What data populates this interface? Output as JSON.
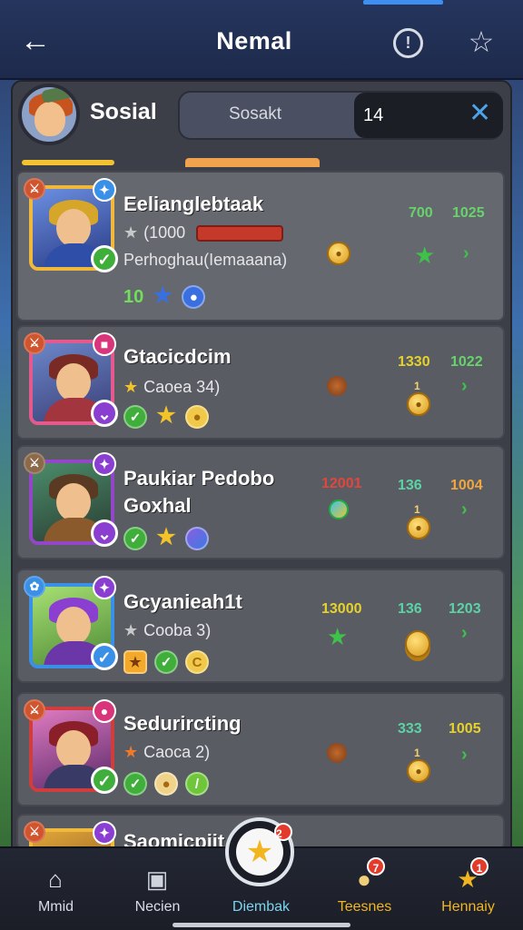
{
  "header": {
    "title": "Nemal"
  },
  "panel": {
    "title": "Sosial",
    "search_label": "Sosakt",
    "search_value": "14"
  },
  "heroes": [
    {
      "name": "Eelianglebtaak",
      "sub": "(1000",
      "desc": "Perhoghau(Iemaaana)",
      "level": "10",
      "stats": [
        "700",
        "1025"
      ],
      "frame": "#f0b93b",
      "badge_tr_color": "#3a8fe6",
      "badge_br_color": "#3fae3a"
    },
    {
      "name": "Gtacicdcim",
      "sub": "Caoea 34)",
      "stats": [
        "1330",
        "1022"
      ],
      "small": "1",
      "frame": "#e55a8d",
      "badge_tr_color": "#d8357a",
      "badge_br_color": "#8a3fd0"
    },
    {
      "name_line1": "Paukiar Pedobo",
      "name_line2": "Goxhal",
      "stats": [
        "12001",
        "136",
        "1004"
      ],
      "small": "1",
      "frame": "#9446c8",
      "badge_tr_color": "#8a3fd0",
      "badge_br_color": "#8a3fd0"
    },
    {
      "name": "Gcyanieah1t",
      "sub": "Cooba 3)",
      "stats": [
        "13000",
        "136",
        "1203"
      ],
      "frame": "#3a8fe6",
      "badge_tr_color": "#8a3fd0",
      "badge_br_color": "#3a8fe6"
    },
    {
      "name": "Sedurircting",
      "sub": "Caoca 2)",
      "stats": [
        "333",
        "1005"
      ],
      "small": "1",
      "frame": "#cf3d3d",
      "badge_tr_color": "#d8357a",
      "badge_br_color": "#3fae3a"
    },
    {
      "name": "Saomicpiit"
    }
  ],
  "nav": {
    "items": [
      {
        "label": "Mmid"
      },
      {
        "label": "Necien"
      },
      {
        "label": "Diembak",
        "badge": "2"
      },
      {
        "label": "Teesnes",
        "badge": "7"
      },
      {
        "label": "Hennaiy",
        "badge": "1"
      }
    ]
  },
  "colors": {
    "accent_blue": "#3e8ff1",
    "tab_yellow": "#f2c230",
    "tab_orange": "#f1a24d",
    "panel_bg": "#3c3f48",
    "card_bg": "#5a5c64",
    "stat_green": "#66d46a",
    "nav_active": "#7bd3f0",
    "nav_gold": "#f2b520"
  },
  "icons": {
    "back": "arrow-left-icon",
    "info": "info-icon",
    "favorite": "star-outline-icon",
    "clear": "close-icon"
  }
}
